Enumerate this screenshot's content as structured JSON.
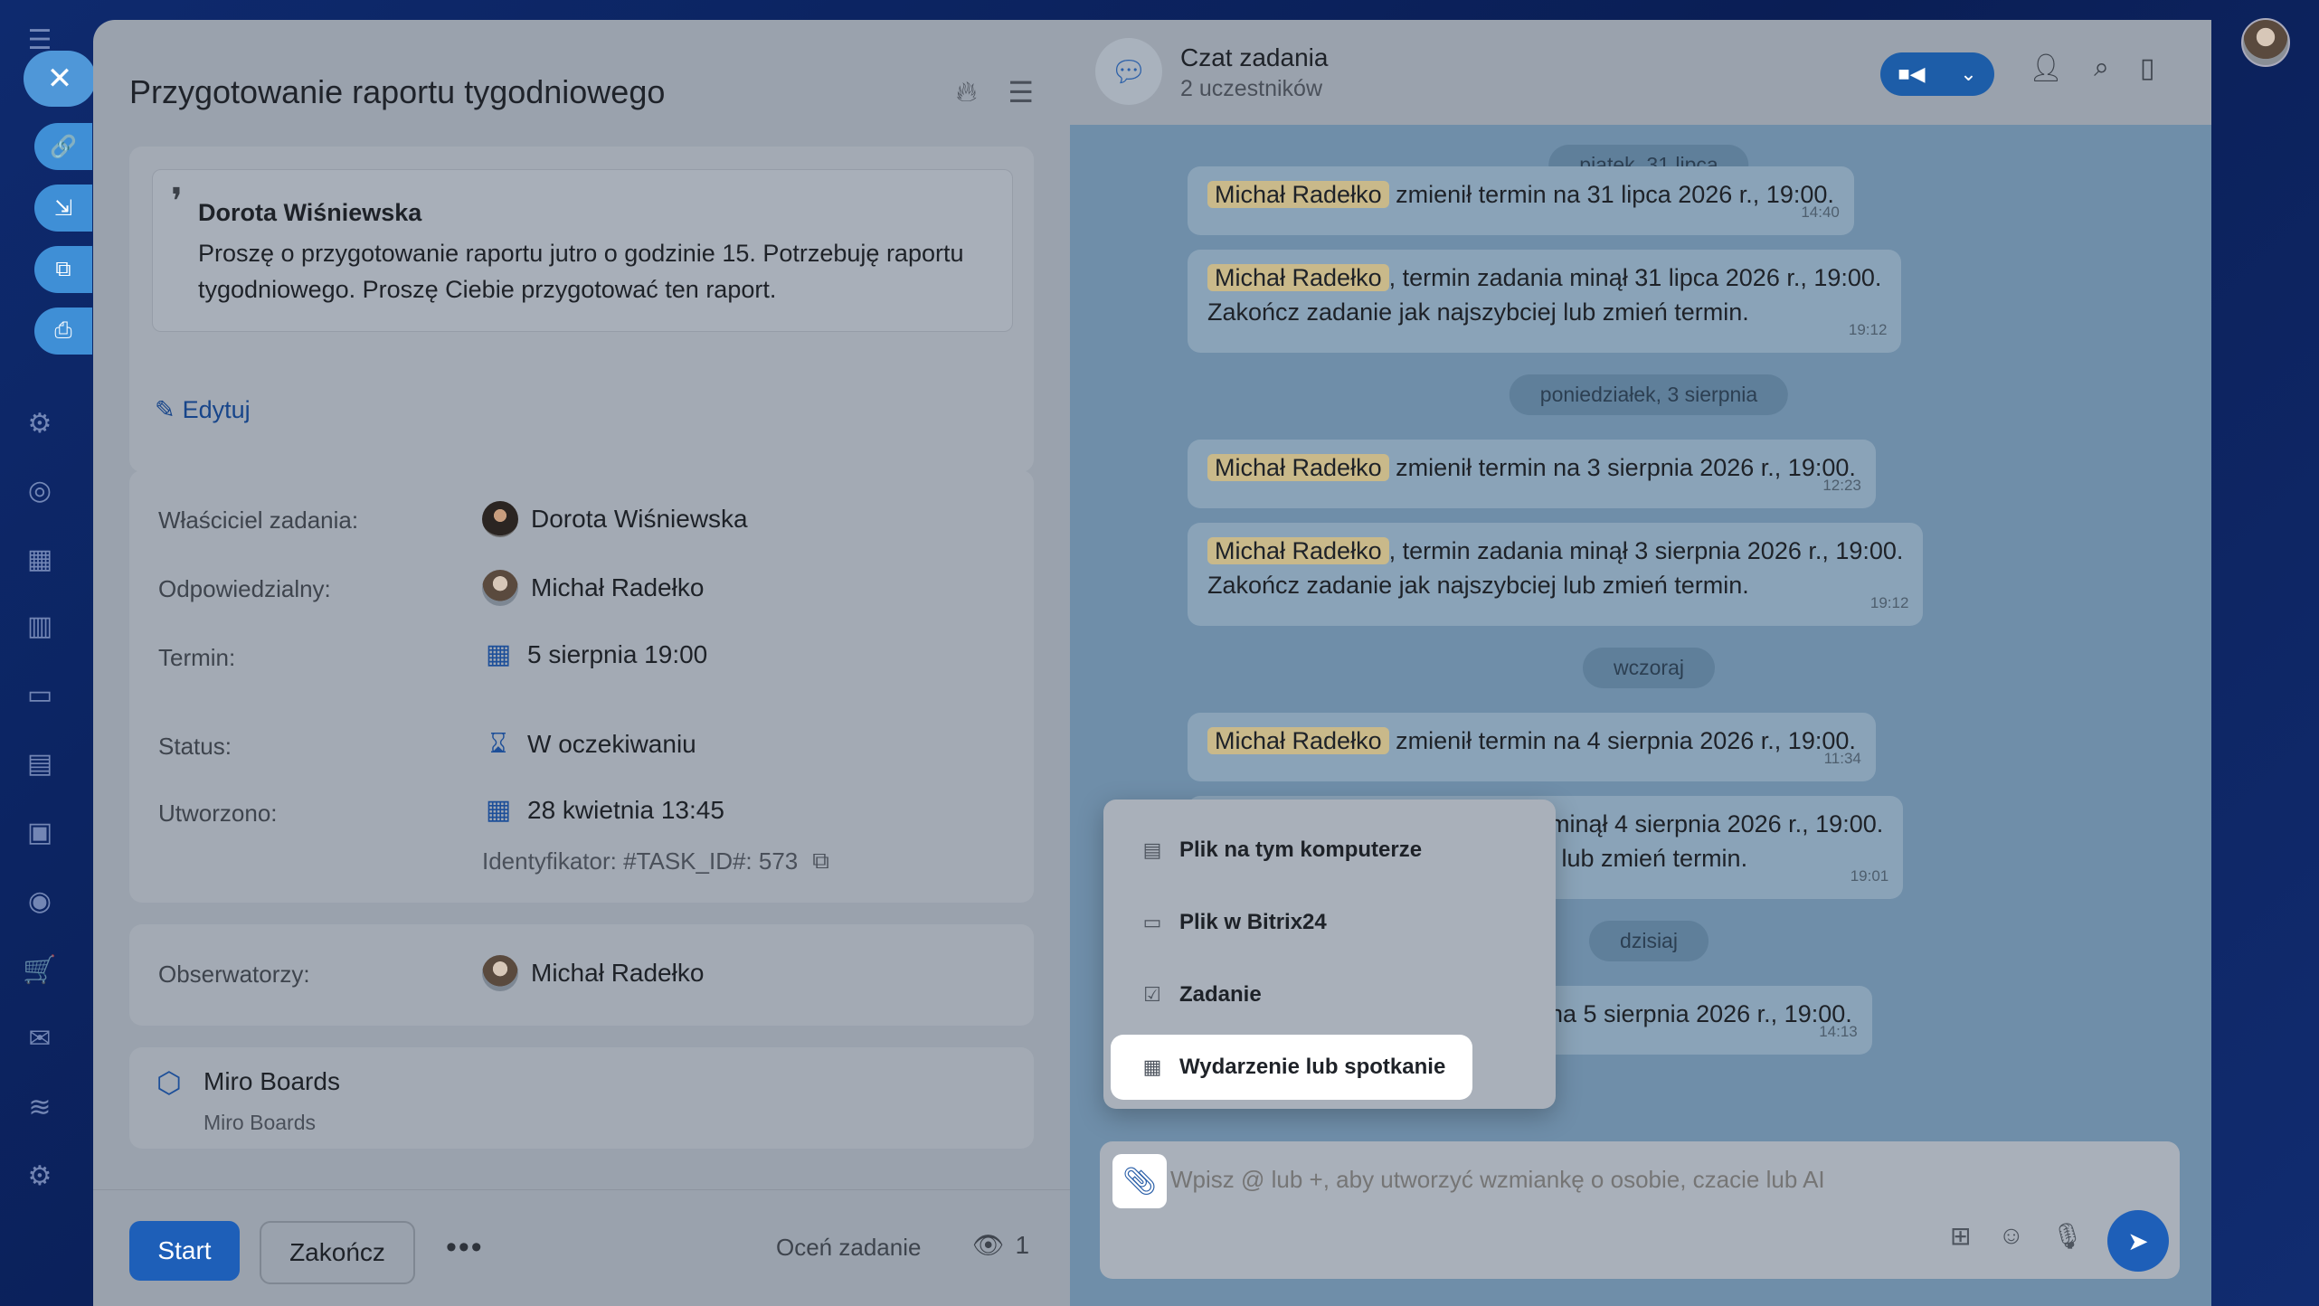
{
  "task": {
    "title": "Przygotowanie raportu tygodniowego",
    "quote_author": "Dorota Wiśniewska",
    "quote_text": "Proszę o przygotowanie raportu jutro o godzinie 15. Potrzebuję raportu tygodniowego. Proszę Ciebie przygotować ten raport.",
    "edit_label": "Edytuj",
    "fields": {
      "owner_label": "Właściciel zadania:",
      "owner_value": "Dorota Wiśniewska",
      "responsible_label": "Odpowiedzialny:",
      "responsible_value": "Michał Radełko",
      "deadline_label": "Termin:",
      "deadline_value": "5 sierpnia 19:00",
      "status_label": "Status:",
      "status_value": "W oczekiwaniu",
      "created_label": "Utworzono:",
      "created_value": "28 kwietnia 13:45",
      "identifier": "Identyfikator: #TASK_ID#: 573",
      "observers_label": "Obserwatorzy:",
      "observers_value": "Michał Radełko"
    },
    "miro": {
      "title": "Miro Boards",
      "subtitle": "Miro Boards"
    },
    "footer": {
      "start_label": "Start",
      "finish_label": "Zakończ",
      "rate_label": "Oceń zadanie",
      "views_count": "1"
    }
  },
  "chat": {
    "title": "Czat zadania",
    "subtitle": "2 uczestników",
    "dates": {
      "d1": "piątek, 31 lipca",
      "d2": "poniedziałek, 3 sierpnia",
      "d3": "wczoraj",
      "d4": "dzisiaj"
    },
    "mention_name": "Michał Radełko",
    "messages": [
      {
        "text": " zmienił termin na 31 lipca 2026 r., 19:00.",
        "time": "14:40"
      },
      {
        "text": ", termin zadania minął 31 lipca 2026 r., 19:00.",
        "text2": "Zakończ zadanie jak najszybciej lub zmień termin.",
        "time": "19:12"
      },
      {
        "text": " zmienił termin na 3 sierpnia 2026 r., 19:00.",
        "time": "12:23"
      },
      {
        "text": ", termin zadania minął 3 sierpnia 2026 r., 19:00.",
        "text2": "Zakończ zadanie jak najszybciej lub zmień termin.",
        "time": "19:12"
      },
      {
        "text": " zmienił termin na 4 sierpnia 2026 r., 19:00.",
        "time": "11:34"
      },
      {
        "text": " minął 4 sierpnia 2026 r., 19:00.",
        "text2": "j lub zmień termin.",
        "time": "19:01"
      },
      {
        "text": " na 5 sierpnia 2026 r., 19:00.",
        "time": "14:13"
      }
    ],
    "attach_menu": {
      "item1": "Plik na tym komputerze",
      "item2": "Plik w Bitrix24",
      "item3": "Zadanie",
      "item4": "Wydarzenie lub spotkanie"
    },
    "input_placeholder": "Wpisz @ lub +, aby utworzyć wzmiankę o osobie, czacie lub AI"
  },
  "colors": {
    "accent": "#1e5fb8",
    "mention": "#c9b98a",
    "chat_bg": "#6f8ea9",
    "panel_bg": "#9aa2ad"
  }
}
